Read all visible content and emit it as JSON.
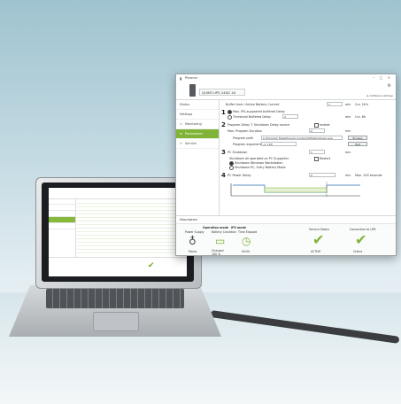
{
  "main_window": {
    "title": "Phoenix",
    "controls": "– □ ×",
    "device_name": "QUINT-UPS 24DC 40",
    "header_right": "► Software settings",
    "sidebar": {
      "items": [
        {
          "label": "Status",
          "icon": ""
        },
        {
          "label": "Settings",
          "icon": ""
        },
        {
          "label": "Monitoring",
          "icon": "monitor-icon"
        },
        {
          "label": "Parameters",
          "icon": "sliders-icon",
          "active": true
        },
        {
          "label": "Service",
          "icon": "wrench-icon"
        }
      ]
    },
    "content": {
      "top_row": {
        "label": "Buffer time / Active Battery Current",
        "value": "1",
        "unit": "min",
        "extra": "Cur. 16 h"
      },
      "step1": {
        "num": "1",
        "option_a": "Max. IPS-supported buffered Delay",
        "option_b": "Threshold Buffered Delay",
        "option_b_value": "2",
        "option_b_unit": "min",
        "option_b_extra": "Cur. 6h"
      },
      "step2": {
        "num": "2",
        "label": "Program Delay T. Shutdown Delay source",
        "checkbox_label": "enable",
        "delay_label": "Max. Program Duration",
        "delay_value": "6",
        "delay_unit": "min",
        "path_label": "Program path",
        "path_value": "C:\\Program Files\\Phoenix Contact\\UPS\\shutdown.exe",
        "browse_button": "Browse",
        "args_label": "Program arguments",
        "args_value": "-s -t 60",
        "test_button": "Test"
      },
      "step3": {
        "num": "3",
        "label": "PC Shutdown",
        "value": "1",
        "unit": "min",
        "lines": [
          "Shutdown all operated on PC Supporter",
          "Shutdown Windows Workstation",
          "Shutdown PC, Entry Battery Mode"
        ],
        "checkbox_label": "Restart"
      },
      "step4": {
        "num": "4",
        "label": "PC Power Delay",
        "value": "0",
        "unit": "min",
        "extra": "Max. 100 seconds"
      }
    },
    "status_label": "Description",
    "bottom": {
      "left_title": "Operation mode",
      "left_value": "IPS mode",
      "col1_label": "Power Supply",
      "col1_value": "Mains",
      "col2_label": "Battery Condition",
      "col2_value": "Charged 100 %",
      "col3_label": "Time Elapsed",
      "col3_value": "00:00",
      "col4_label": "Service Status",
      "col4_value": "ACTIVE",
      "col5_label": "Connection to UPS",
      "col5_value": "Online"
    }
  },
  "colors": {
    "accent": "#7fb437",
    "check": "#7aa92f"
  }
}
